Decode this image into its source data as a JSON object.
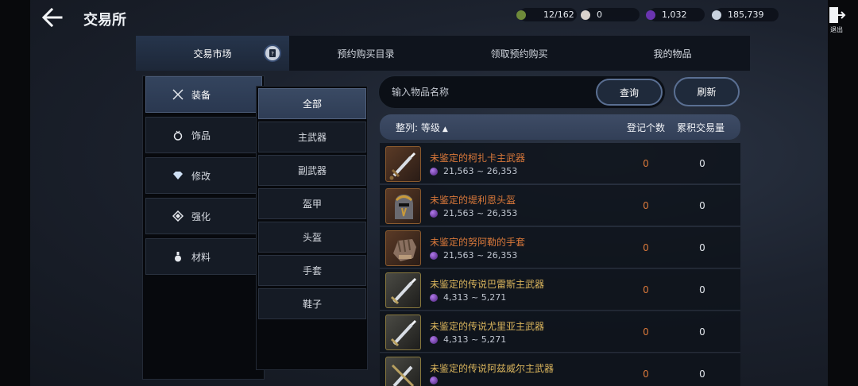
{
  "header": {
    "title": "交易所",
    "exit_label": "退出"
  },
  "currencies": [
    {
      "icon": "leaf-gem-icon",
      "value": "12/162",
      "color": "#6e8a3a"
    },
    {
      "icon": "pearl-icon",
      "value": "0",
      "color": "#d9d2cc"
    },
    {
      "icon": "dark-crystal-icon",
      "value": "1,032",
      "color": "#6a34b0"
    },
    {
      "icon": "silver-coin-icon",
      "value": "185,739",
      "color": "#c9d3e0"
    }
  ],
  "tabs": [
    {
      "label": "交易市场",
      "active": true
    },
    {
      "label": "预约购买目录"
    },
    {
      "label": "领取预约购买"
    },
    {
      "label": "我的物品"
    }
  ],
  "categories": [
    {
      "label": "装备",
      "icon": "crossed-swords-icon",
      "active": true
    },
    {
      "label": "饰品",
      "icon": "ring-icon"
    },
    {
      "label": "修改",
      "icon": "diamond-icon"
    },
    {
      "label": "强化",
      "icon": "reinforce-icon"
    },
    {
      "label": "材料",
      "icon": "flask-icon"
    }
  ],
  "subcategories": [
    {
      "label": "全部",
      "active": true
    },
    {
      "label": "主武器"
    },
    {
      "label": "副武器"
    },
    {
      "label": "盔甲"
    },
    {
      "label": "头盔"
    },
    {
      "label": "手套"
    },
    {
      "label": "鞋子"
    }
  ],
  "search": {
    "placeholder": "输入物品名称",
    "query_label": "查询",
    "refresh_label": "刷新"
  },
  "table": {
    "sort_label": "整列: 等级",
    "sort_arrow": "▲",
    "col_count": "登记个数",
    "col_volume": "累积交易量",
    "rows": [
      {
        "name": "未鉴定的柯扎卡主武器",
        "grade": "orange",
        "icon": "sword-icon",
        "price": "21,563 ~ 26,353",
        "count": "0",
        "volume": "0"
      },
      {
        "name": "未鉴定的堤利恩头盔",
        "grade": "orange",
        "icon": "helmet-icon",
        "price": "21,563 ~ 26,353",
        "count": "0",
        "volume": "0"
      },
      {
        "name": "未鉴定的努阿勒的手套",
        "grade": "orange",
        "icon": "gauntlet-icon",
        "price": "21,563 ~ 26,353",
        "count": "0",
        "volume": "0"
      },
      {
        "name": "未鉴定的传说巴雷斯主武器",
        "grade": "gold",
        "icon": "sword-icon",
        "price": "4,313 ~ 5,271",
        "count": "0",
        "volume": "0"
      },
      {
        "name": "未鉴定的传说尤里亚主武器",
        "grade": "gold",
        "icon": "sword-icon",
        "price": "4,313 ~ 5,271",
        "count": "0",
        "volume": "0"
      },
      {
        "name": "未鉴定的传说阿兹威尔主武器",
        "grade": "gold",
        "icon": "sword-icon",
        "price": "",
        "count": "0",
        "volume": "0"
      }
    ]
  }
}
